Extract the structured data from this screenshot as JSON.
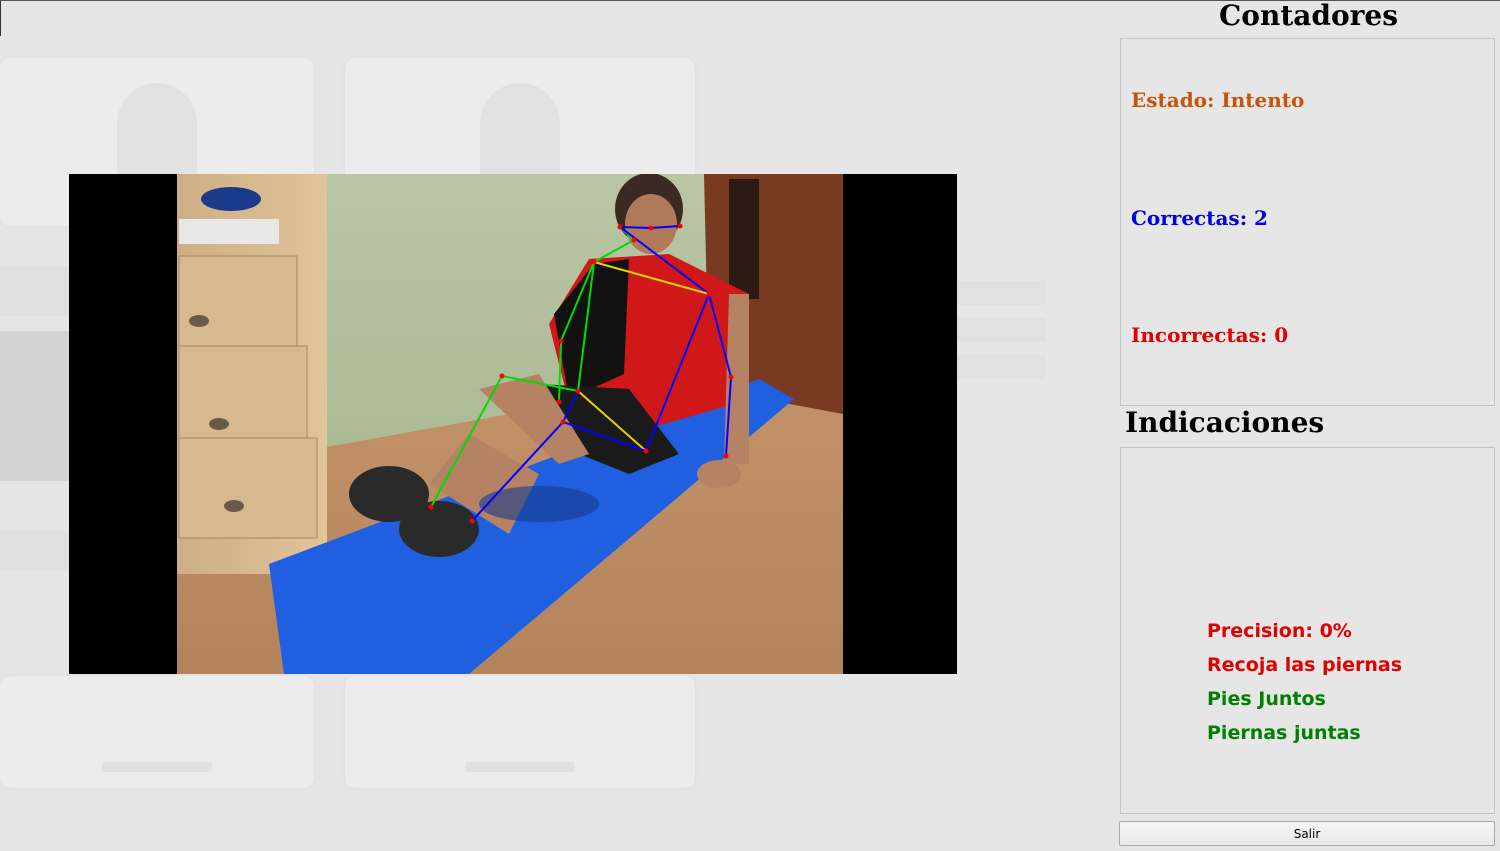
{
  "counters": {
    "title": "Contadores",
    "estado": "Estado: Intento",
    "correctas": "Correctas: 2",
    "incorrectas": "Incorrectas: 0"
  },
  "indications": {
    "title": "Indicaciones",
    "items": [
      {
        "text": "Precision: 0%",
        "color": "#e00000"
      },
      {
        "text": "Recoja las piernas",
        "color": "#e00000"
      },
      {
        "text": "Pies Juntos",
        "color": "#008000"
      },
      {
        "text": "Piernas juntas",
        "color": "#008000"
      }
    ]
  },
  "exit_button": {
    "label": "Salir"
  },
  "colors": {
    "estado": "#c8530a",
    "correctas": "#0000e0",
    "incorrectas": "#e00000",
    "skeleton_left": "#00dd00",
    "skeleton_right": "#0000ff",
    "skeleton_cross": "#e6d200",
    "joint": "#ff0000",
    "mat": "#1f5fe0"
  }
}
